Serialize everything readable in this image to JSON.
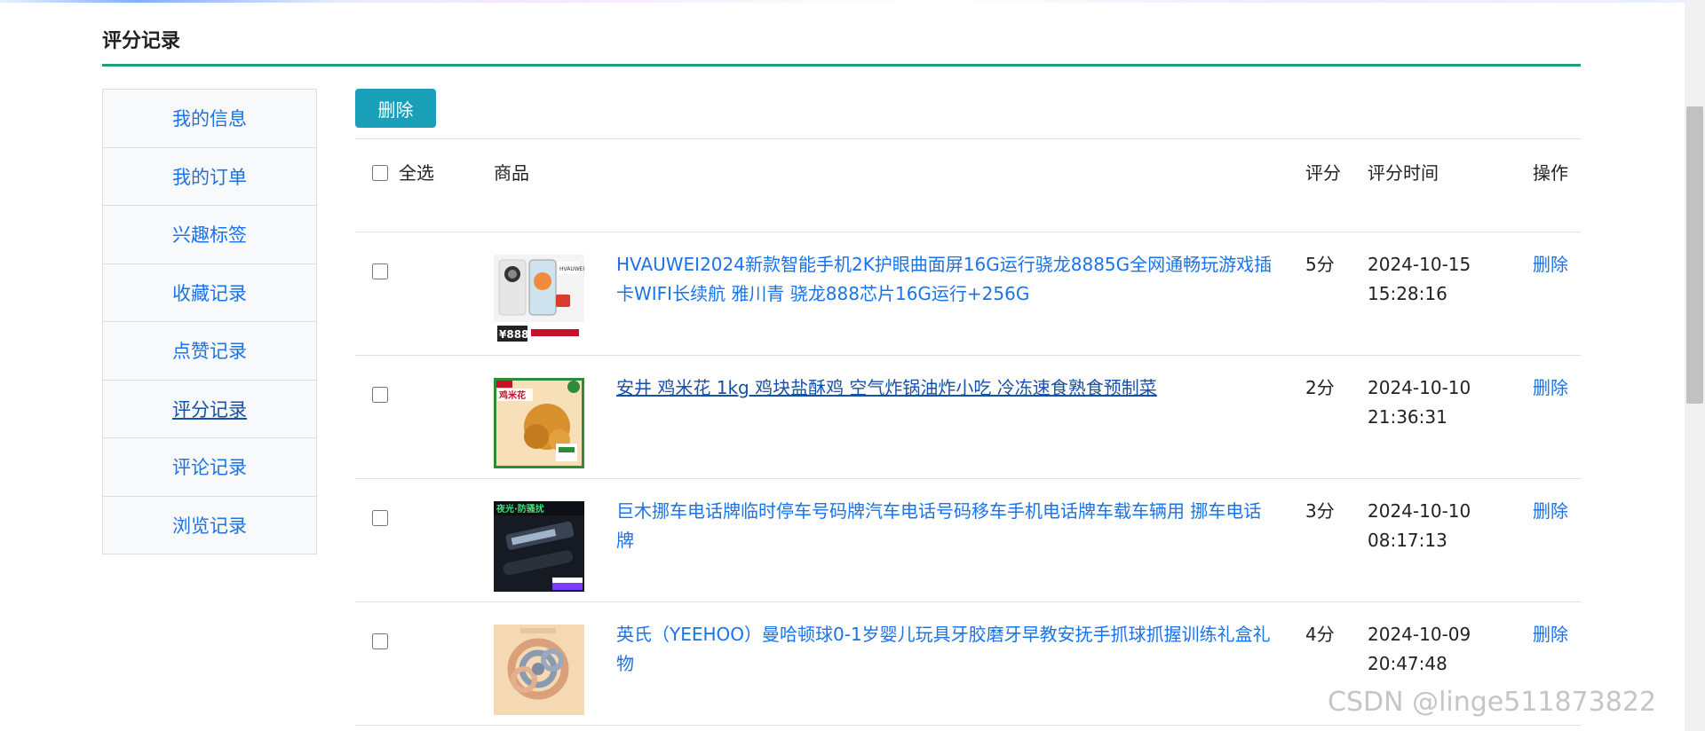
{
  "page_title": "评分记录",
  "sidebar": {
    "items": [
      {
        "label": "我的信息"
      },
      {
        "label": "我的订单"
      },
      {
        "label": "兴趣标签"
      },
      {
        "label": "收藏记录"
      },
      {
        "label": "点赞记录"
      },
      {
        "label": "评分记录",
        "active": true
      },
      {
        "label": "评论记录"
      },
      {
        "label": "浏览记录"
      }
    ]
  },
  "toolbar": {
    "delete_label": "删除"
  },
  "table": {
    "headers": {
      "select_all": "全选",
      "goods": "商品",
      "score": "评分",
      "time": "评分时间",
      "op": "操作"
    },
    "rows": [
      {
        "name": "HVAUWEI2024新款智能手机2K护眼曲面屏16G运行骁龙8885G全网通畅玩游戏插卡WIFI长续航 雅川青 骁龙888芯片16G运行+256G",
        "score": "5分",
        "time": "2024-10-15 15:28:16",
        "op": "删除",
        "thumb": "phone",
        "visited": false
      },
      {
        "name": "安井 鸡米花 1kg 鸡块盐酥鸡 空气炸锅油炸小吃 冷冻速食熟食预制菜",
        "score": "2分",
        "time": "2024-10-10 21:36:31",
        "op": "删除",
        "thumb": "chicken",
        "visited": true
      },
      {
        "name": "巨木挪车电话牌临时停车号码牌汽车电话号码移车手机电话牌车载车辆用 挪车电话牌",
        "score": "3分",
        "time": "2024-10-10 08:17:13",
        "op": "删除",
        "thumb": "parking",
        "visited": false
      },
      {
        "name": "英氏（YEEHOO）曼哈顿球0-1岁婴儿玩具牙胶磨牙早教安抚手抓球抓握训练礼盒礼物",
        "score": "4分",
        "time": "2024-10-09 20:47:48",
        "op": "删除",
        "thumb": "toy",
        "visited": false
      }
    ]
  },
  "thumb_labels": {
    "phone_price": "¥888",
    "chicken_text": "鸡米花",
    "parking_text": "夜光·防骚扰"
  },
  "watermark": "CSDN @linge511873822",
  "colors": {
    "accent": "#1aa37a",
    "link": "#1a73e8",
    "button": "#1a9fb8"
  }
}
